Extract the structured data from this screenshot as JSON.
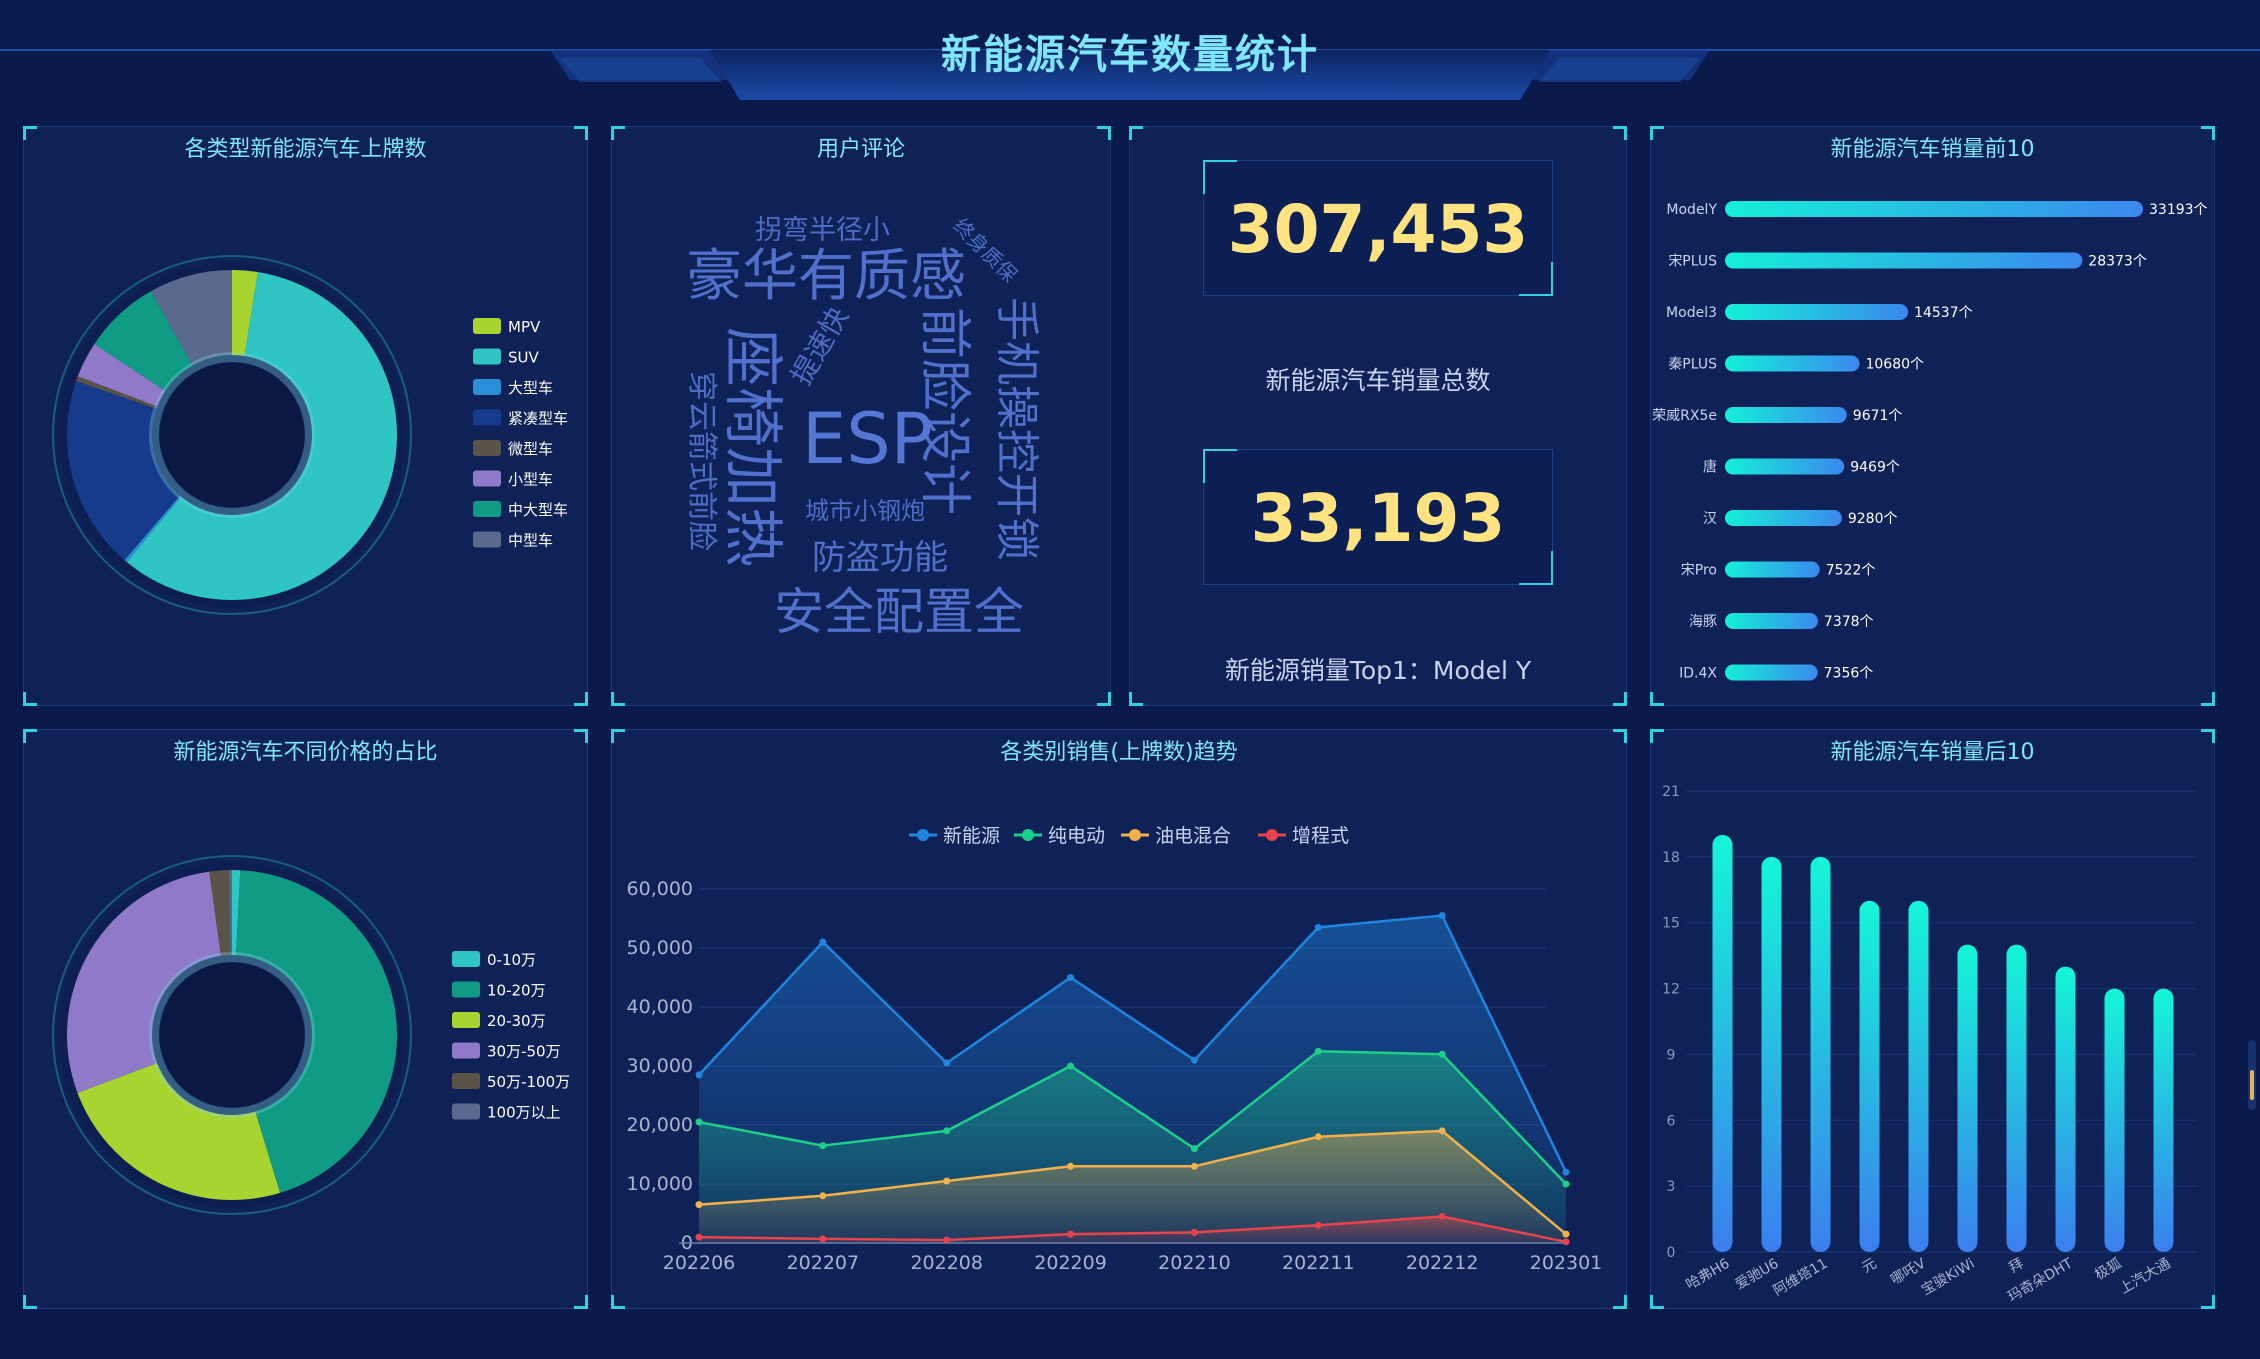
{
  "header": {
    "title": "新能源汽车数量统计"
  },
  "colors": {
    "accent": "#2fd3e0",
    "title": "#7fe6ff",
    "number": "#ffe380"
  },
  "panels": {
    "type_donut": {
      "title": "各类型新能源汽车上牌数"
    },
    "word_cloud": {
      "title": "用户评论"
    },
    "stats": {
      "total_value": "307,453",
      "total_label": "新能源汽车销量总数",
      "top1_value": "33,193",
      "top1_label": "新能源销量Top1：Model Y"
    },
    "top10": {
      "title": "新能源汽车销量前10"
    },
    "price_donut": {
      "title": "新能源汽车不同价格的占比"
    },
    "trend": {
      "title": "各类别销售(上牌数)趋势"
    },
    "bottom10": {
      "title": "新能源汽车销量后10"
    }
  },
  "word_cloud_words": [
    "拐弯半径小",
    "终身质保",
    "豪华有质感",
    "手机操控开锁",
    "前脸设计",
    "提速快",
    "座椅加热",
    "ESP",
    "穿云箭式前脸",
    "城市小钢炮",
    "防盗功能",
    "安全配置全"
  ],
  "chart_data": [
    {
      "type": "pie",
      "id": "type_donut",
      "title": "各类型新能源汽车上牌数",
      "labels": [
        "MPV",
        "SUV",
        "大型车",
        "紧凑型车",
        "微型车",
        "小型车",
        "中大型车",
        "中型车"
      ],
      "values": [
        2.5,
        58.5,
        0.3,
        19,
        0.5,
        3.5,
        7.5,
        8.2
      ],
      "colors": [
        "#a8d42f",
        "#2ec5c2",
        "#2a8fd6",
        "#163a8c",
        "#5a5448",
        "#8f79c8",
        "#0f9b84",
        "#5a6a8e"
      ]
    },
    {
      "type": "pie",
      "id": "price_donut",
      "title": "新能源汽车不同价格的占比",
      "labels": [
        "0-10万",
        "10-20万",
        "20-30万",
        "30万-50万",
        "50万-100万",
        "100万以上"
      ],
      "values": [
        0.8,
        44.5,
        24,
        28.5,
        1.9,
        0.3
      ],
      "colors": [
        "#2ec5c2",
        "#0f9b84",
        "#a8d42f",
        "#8f79c8",
        "#5a5448",
        "#5a6a8e"
      ]
    },
    {
      "type": "bar",
      "id": "top10",
      "title": "新能源汽车销量前10",
      "categories": [
        "ModelY",
        "宋PLUS",
        "Model3",
        "秦PLUS",
        "荣威RX5e",
        "唐",
        "汉",
        "宋Pro",
        "海豚",
        "ID.4X"
      ],
      "values": [
        33193,
        28373,
        14537,
        10680,
        9671,
        9469,
        9280,
        7522,
        7378,
        7356
      ],
      "value_labels": [
        "33193个",
        "28373个",
        "14537个",
        "10680个",
        "9671个",
        "9469个",
        "9280个",
        "7522个",
        "7378个",
        "7356个"
      ],
      "xlim": [
        0,
        33193
      ]
    },
    {
      "type": "area",
      "id": "trend",
      "title": "各类别销售(上牌数)趋势",
      "x": [
        "202206",
        "202207",
        "202208",
        "202209",
        "202210",
        "202211",
        "202212",
        "202301"
      ],
      "ylim": [
        0,
        60000
      ],
      "yticks": [
        0,
        10000,
        20000,
        30000,
        40000,
        50000,
        60000
      ],
      "ytick_labels": [
        "0",
        "10,000",
        "20,000",
        "30,000",
        "40,000",
        "50,000",
        "60,000"
      ],
      "series": [
        {
          "name": "新能源",
          "color": "#1f86e0",
          "values": [
            28500,
            51000,
            30500,
            45000,
            31000,
            53500,
            55500,
            12000
          ]
        },
        {
          "name": "纯电动",
          "color": "#1dd08a",
          "values": [
            20500,
            16500,
            19000,
            30000,
            16000,
            32500,
            32000,
            10000
          ]
        },
        {
          "name": "油电混合",
          "color": "#f2b14a",
          "values": [
            6500,
            8000,
            10500,
            13000,
            13000,
            18000,
            19000,
            1500
          ]
        },
        {
          "name": "增程式",
          "color": "#e8434a",
          "values": [
            1000,
            700,
            500,
            1500,
            1800,
            3000,
            4500,
            200
          ]
        }
      ]
    },
    {
      "type": "bar",
      "id": "bottom10",
      "title": "新能源汽车销量后10",
      "categories": [
        "哈弗H6",
        "爱驰U6",
        "阿维塔11",
        "元",
        "哪吒V",
        "宝骏KiWi",
        "拜",
        "玛奇朵DHT",
        "极狐",
        "上汽大通"
      ],
      "values": [
        19,
        18,
        18,
        16,
        16,
        14,
        14,
        13,
        12,
        12
      ],
      "ylim": [
        0,
        21
      ],
      "yticks": [
        0,
        3,
        6,
        9,
        12,
        15,
        18,
        21
      ],
      "ytick_labels": [
        "0",
        "3",
        "6",
        "9",
        "12",
        "15",
        "18",
        "21"
      ]
    }
  ]
}
